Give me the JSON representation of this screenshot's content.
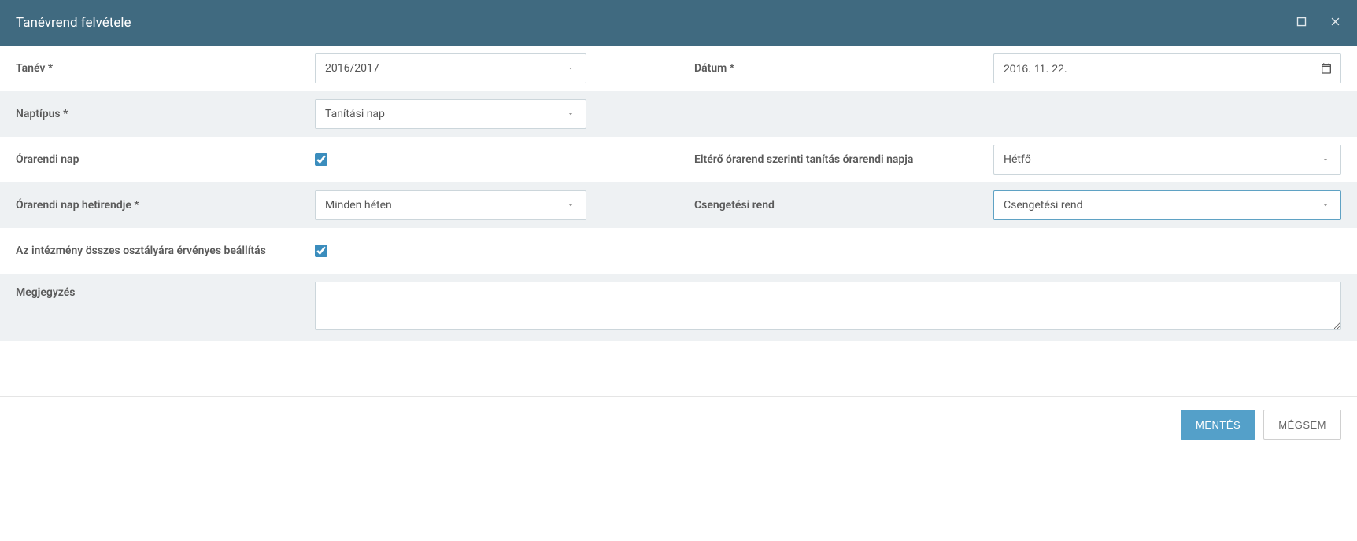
{
  "dialog": {
    "title": "Tanévrend felvétele"
  },
  "fields": {
    "tanev": {
      "label": "Tanév *",
      "value": "2016/2017"
    },
    "datum": {
      "label": "Dátum *",
      "value": "2016. 11. 22."
    },
    "naptipus": {
      "label": "Naptípus *",
      "value": "Tanítási nap"
    },
    "orarendi_nap": {
      "label": "Órarendi nap",
      "checked": true
    },
    "eltero": {
      "label": "Eltérő órarend szerinti tanítás órarendi napja",
      "value": "Hétfő"
    },
    "hetirend": {
      "label": "Órarendi nap hetirendje *",
      "value": "Minden héten"
    },
    "csengetesi": {
      "label": "Csengetési rend",
      "value": "Csengetési rend"
    },
    "osszes_osztaly": {
      "label": "Az intézmény összes osztályára érvényes beállítás",
      "checked": true
    },
    "megjegyzes": {
      "label": "Megjegyzés",
      "value": ""
    }
  },
  "buttons": {
    "save": "MENTÉS",
    "cancel": "MÉGSEM"
  }
}
